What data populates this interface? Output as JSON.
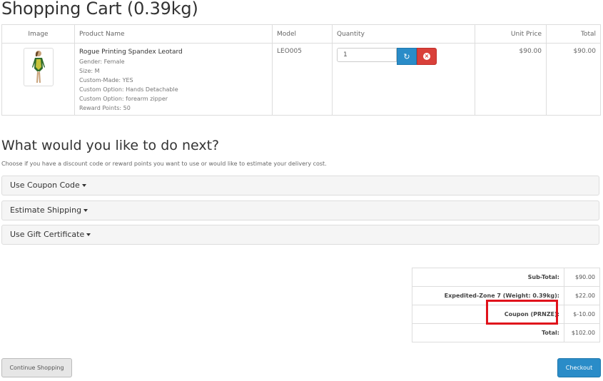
{
  "page": {
    "title": "Shopping Cart  (0.39kg)"
  },
  "cart": {
    "headers": {
      "image": "Image",
      "product_name": "Product Name",
      "model": "Model",
      "quantity": "Quantity",
      "unit_price": "Unit Price",
      "total": "Total"
    },
    "item": {
      "image_icon": "leotard-product-image",
      "name": "Rogue Printing Spandex Leotard",
      "options": [
        "Gender: Female",
        "Size: M",
        "Custom-Made: YES",
        "Custom Option: Hands Detachable",
        "Custom Option: forearm zipper",
        "Reward Points: 50"
      ],
      "model": "LEO005",
      "quantity": "1",
      "unit_price": "$90.00",
      "total": "$90.00"
    }
  },
  "next": {
    "title": "What would you like to do next?",
    "description": "Choose if you have a discount code or reward points you want to use or would like to estimate your delivery cost.",
    "panels": [
      "Use Coupon Code",
      "Estimate Shipping",
      "Use Gift Certificate"
    ]
  },
  "totals": [
    {
      "label": "Sub-Total:",
      "value": "$90.00"
    },
    {
      "label": "Expedited-Zone 7 (Weight: 0.39kg):",
      "value": "$22.00"
    },
    {
      "label": "Coupon (PRNZE):",
      "value": "$-10.00"
    },
    {
      "label": "Total:",
      "value": "$102.00"
    }
  ],
  "buttons": {
    "continue": "Continue Shopping",
    "checkout": "Checkout"
  },
  "colors": {
    "primary": "#2a8cc8",
    "danger": "#d9403a",
    "highlight": "#e0121b"
  }
}
